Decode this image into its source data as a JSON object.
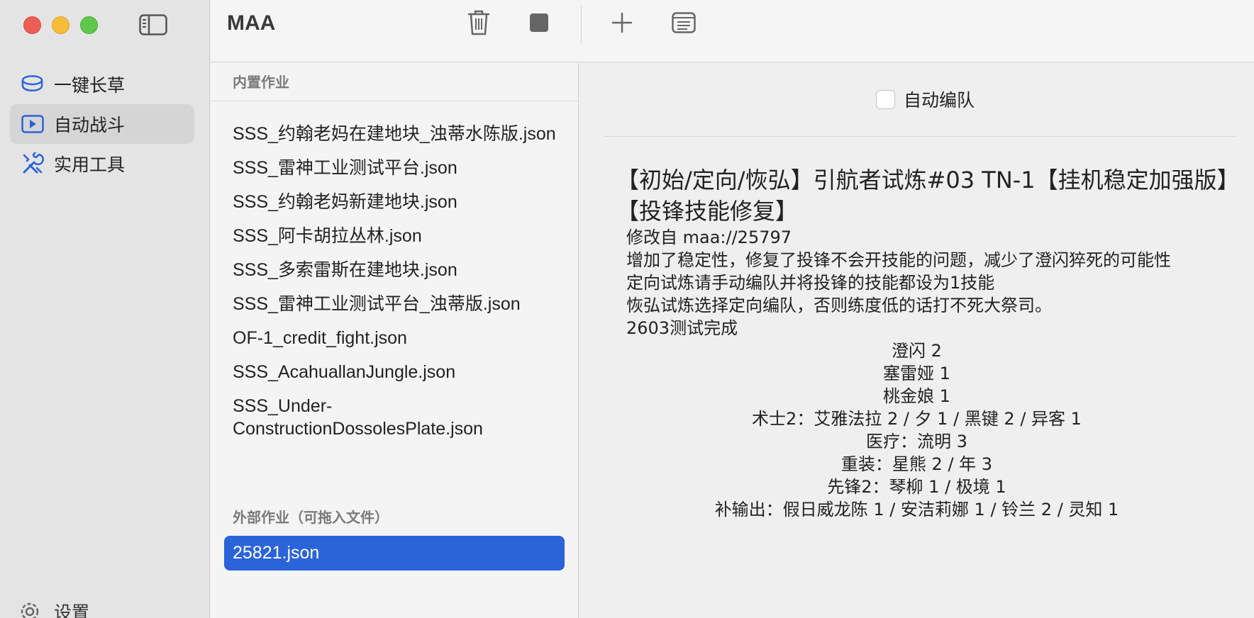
{
  "app": {
    "title": "MAA"
  },
  "sidebar": {
    "items": [
      {
        "label": "一键长草",
        "icon": "tray-icon"
      },
      {
        "label": "自动战斗",
        "icon": "play-rectangle-icon"
      },
      {
        "label": "实用工具",
        "icon": "tools-icon"
      }
    ],
    "active_index": 1,
    "settings_label": "设置"
  },
  "list": {
    "builtin_header": "内置作业",
    "builtin_items": [
      "SSS_约翰老妈在建地块_浊蒂水陈版.json",
      "SSS_雷神工业测试平台.json",
      "SSS_约翰老妈新建地块.json",
      "SSS_阿卡胡拉丛林.json",
      "SSS_多索雷斯在建地块.json",
      "SSS_雷神工业测试平台_浊蒂版.json",
      "OF-1_credit_fight.json",
      "SSS_AcahuallanJungle.json",
      "SSS_Under-ConstructionDossolesPlate.json"
    ],
    "external_header": "外部作业（可拖入文件）",
    "external_items": [
      "25821.json"
    ],
    "selected": "25821.json"
  },
  "detail": {
    "auto_team_label": "自动编队",
    "auto_team_checked": false,
    "title": "【初始/定向/恢弘】引航者试炼#03 TN-1【挂机稳定加强版】【投锋技能修复】",
    "lines": [
      "修改自 maa://25797",
      "增加了稳定性，修复了投锋不会开技能的问题，减少了澄闪猝死的可能性",
      "定向试炼请手动编队并将投锋的技能都设为1技能",
      "恢弘试炼选择定向编队，否则练度低的话打不死大祭司。",
      "2603测试完成"
    ],
    "operators": [
      "澄闪 2",
      "塞雷娅 1",
      "桃金娘 1",
      "术士2：艾雅法拉 2 / 夕 1 / 黑键 2 / 异客 1",
      "医疗：流明 3",
      "重装：星熊 2 / 年 3",
      "先锋2：琴柳 1 / 极境 1",
      "补输出：假日威龙陈 1 / 安洁莉娜 1 / 铃兰 2 / 灵知 1"
    ]
  },
  "colors": {
    "accent": "#2b63d9",
    "sidebar_bg": "#e4e4e4",
    "icon_blue": "#2b63d9"
  }
}
